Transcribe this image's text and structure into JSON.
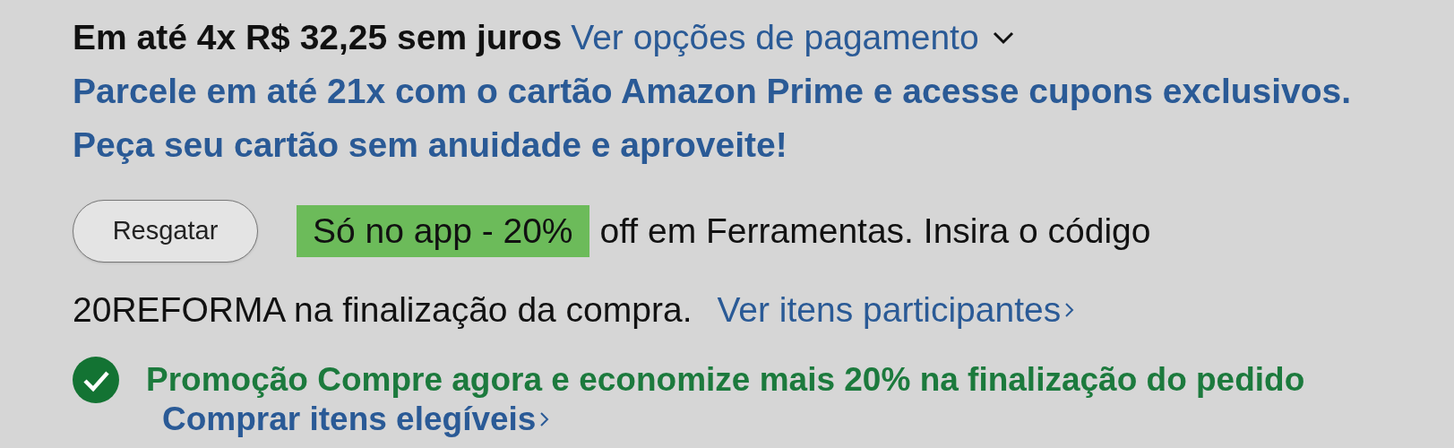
{
  "payment": {
    "installments": "Em até 4x R$ 32,25 sem juros",
    "options_link": "Ver opções de pagamento"
  },
  "card_offer": [
    "Parcele em até 21x com o cartão Amazon Prime e acesse cupons exclusivos.",
    "Peça seu cartão sem anuidade e aproveite!"
  ],
  "coupon": {
    "button": "Resgatar",
    "badge": "Só no app - 20%",
    "text_1": "off em Ferramentas. Insira o código",
    "text_2": "20REFORMA na finalização da compra.",
    "link": "Ver itens participantes"
  },
  "promotion": {
    "applied": true,
    "text": "Promoção Compre agora e economize mais 20% na finalização do pedido",
    "link": "Comprar itens elegíveis"
  }
}
